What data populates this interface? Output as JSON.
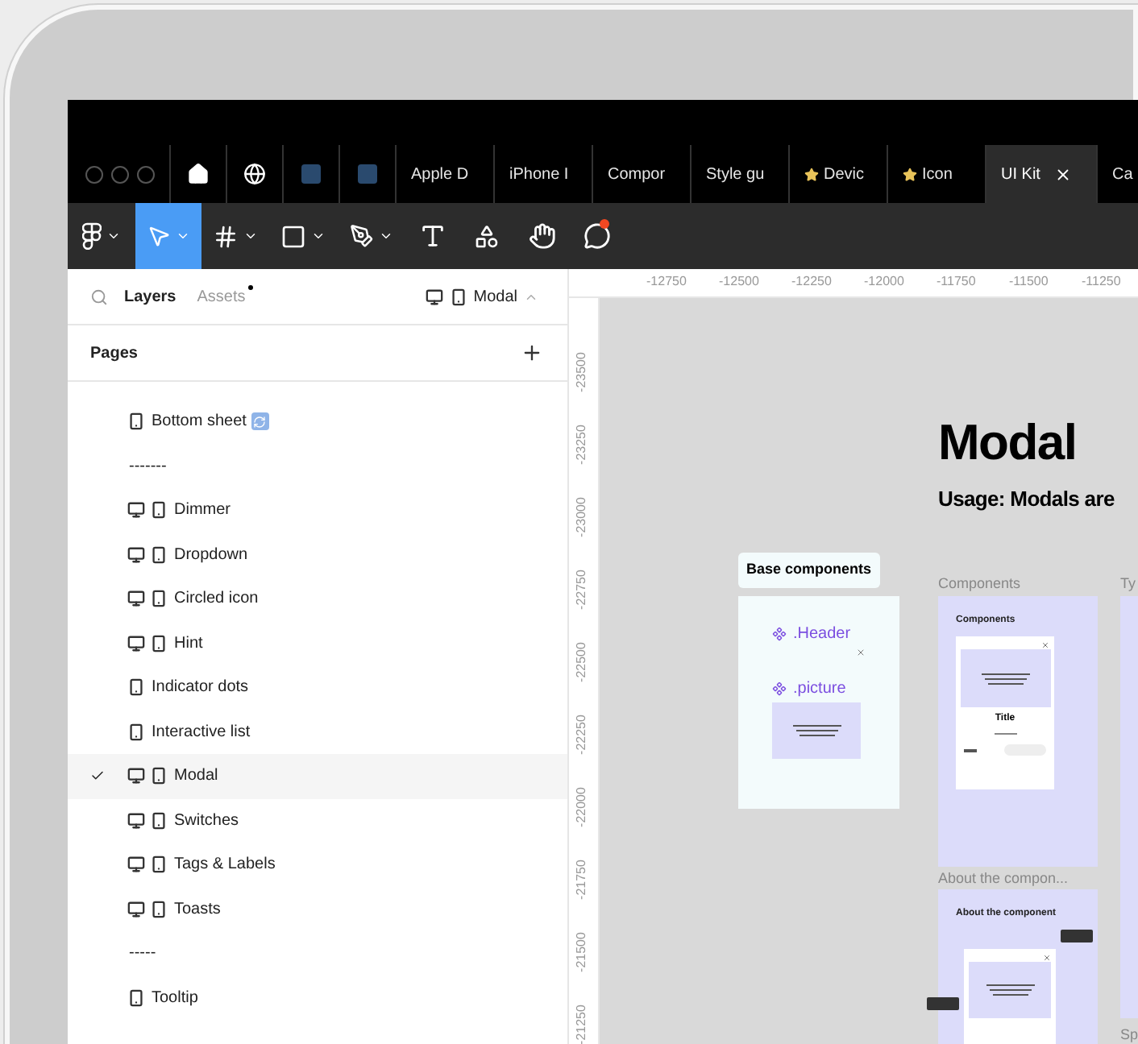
{
  "tabs": [
    {
      "kind": "home",
      "selected": false
    },
    {
      "kind": "globe",
      "selected": false
    },
    {
      "kind": "file",
      "selected": false
    },
    {
      "kind": "file",
      "selected": false
    },
    {
      "kind": "text",
      "label": "Apple D",
      "starred": false,
      "selected": false
    },
    {
      "kind": "text",
      "label": "iPhone I",
      "starred": false,
      "selected": false
    },
    {
      "kind": "text",
      "label": "Compor",
      "starred": false,
      "selected": false
    },
    {
      "kind": "text",
      "label": "Style gu",
      "starred": false,
      "selected": false
    },
    {
      "kind": "text",
      "label": "Devic",
      "starred": true,
      "selected": false
    },
    {
      "kind": "text",
      "label": "Icon",
      "starred": true,
      "selected": false
    },
    {
      "kind": "text",
      "label": "UI Kit",
      "starred": false,
      "selected": true
    },
    {
      "kind": "text",
      "label": "Ca",
      "starred": false,
      "selected": false
    }
  ],
  "toolbar": [
    {
      "kind": "main-menu",
      "selected": false,
      "has_menu": true,
      "notification": false
    },
    {
      "kind": "move",
      "selected": true,
      "has_menu": true,
      "notification": false
    },
    {
      "kind": "frame",
      "selected": false,
      "has_menu": true,
      "notification": false
    },
    {
      "kind": "rectangle",
      "selected": false,
      "has_menu": true,
      "notification": false
    },
    {
      "kind": "pen",
      "selected": false,
      "has_menu": true,
      "notification": false
    },
    {
      "kind": "text",
      "selected": false,
      "has_menu": false,
      "notification": false
    },
    {
      "kind": "resources",
      "selected": false,
      "has_menu": false,
      "notification": false
    },
    {
      "kind": "hand",
      "selected": false,
      "has_menu": false,
      "notification": false
    },
    {
      "kind": "comment",
      "selected": false,
      "has_menu": false,
      "notification": true
    }
  ],
  "panel": {
    "tabs": [
      {
        "label": "Layers",
        "selected": true,
        "dot": false
      },
      {
        "label": "Assets",
        "selected": false,
        "dot": true
      }
    ],
    "page_switcher": {
      "label": "Modal",
      "desktop": true,
      "phone": true
    },
    "pages_title": "Pages",
    "pages": [
      {
        "label": "Bottom sheet",
        "desktop": false,
        "phone": true,
        "badge": true,
        "selected": false
      },
      {
        "label": "-------",
        "desktop": false,
        "phone": false,
        "badge": false,
        "selected": false
      },
      {
        "label": "Dimmer",
        "desktop": true,
        "phone": true,
        "badge": false,
        "selected": false
      },
      {
        "label": "Dropdown",
        "desktop": true,
        "phone": true,
        "badge": false,
        "selected": false
      },
      {
        "label": "Circled icon",
        "desktop": true,
        "phone": true,
        "badge": false,
        "selected": false
      },
      {
        "label": "Hint",
        "desktop": true,
        "phone": true,
        "badge": false,
        "selected": false
      },
      {
        "label": "Indicator dots",
        "desktop": false,
        "phone": true,
        "badge": false,
        "selected": false
      },
      {
        "label": "Interactive list",
        "desktop": false,
        "phone": true,
        "badge": false,
        "selected": false
      },
      {
        "label": "Modal",
        "desktop": true,
        "phone": true,
        "badge": false,
        "selected": true
      },
      {
        "label": "Switches",
        "desktop": true,
        "phone": true,
        "badge": false,
        "selected": false
      },
      {
        "label": "Tags & Labels",
        "desktop": true,
        "phone": true,
        "badge": false,
        "selected": false
      },
      {
        "label": "Toasts",
        "desktop": true,
        "phone": true,
        "badge": false,
        "selected": false
      },
      {
        "label": "-----",
        "desktop": false,
        "phone": false,
        "badge": false,
        "selected": false
      },
      {
        "label": "Tooltip",
        "desktop": false,
        "phone": true,
        "badge": false,
        "selected": false
      }
    ]
  },
  "rulers": {
    "horizontal": [
      "-12750",
      "-12500",
      "-12250",
      "-12000",
      "-11750",
      "-11500",
      "-11250"
    ],
    "vertical": [
      "-23500",
      "-23250",
      "-23000",
      "-22750",
      "-22500",
      "-22250",
      "-22000",
      "-21750",
      "-21500",
      "-21250"
    ]
  },
  "canvas": {
    "title": "Modal",
    "subtitle": "Usage: Modals are",
    "base": {
      "label": "Base components",
      "items": [
        ".Header",
        ".picture"
      ]
    },
    "sections": [
      {
        "label": "Components",
        "card_title": "Components",
        "modal_title": "Title"
      },
      {
        "label": "About the compon...",
        "card_title": "About the component"
      }
    ],
    "cut_labels": [
      "Ty",
      "Sp"
    ]
  }
}
